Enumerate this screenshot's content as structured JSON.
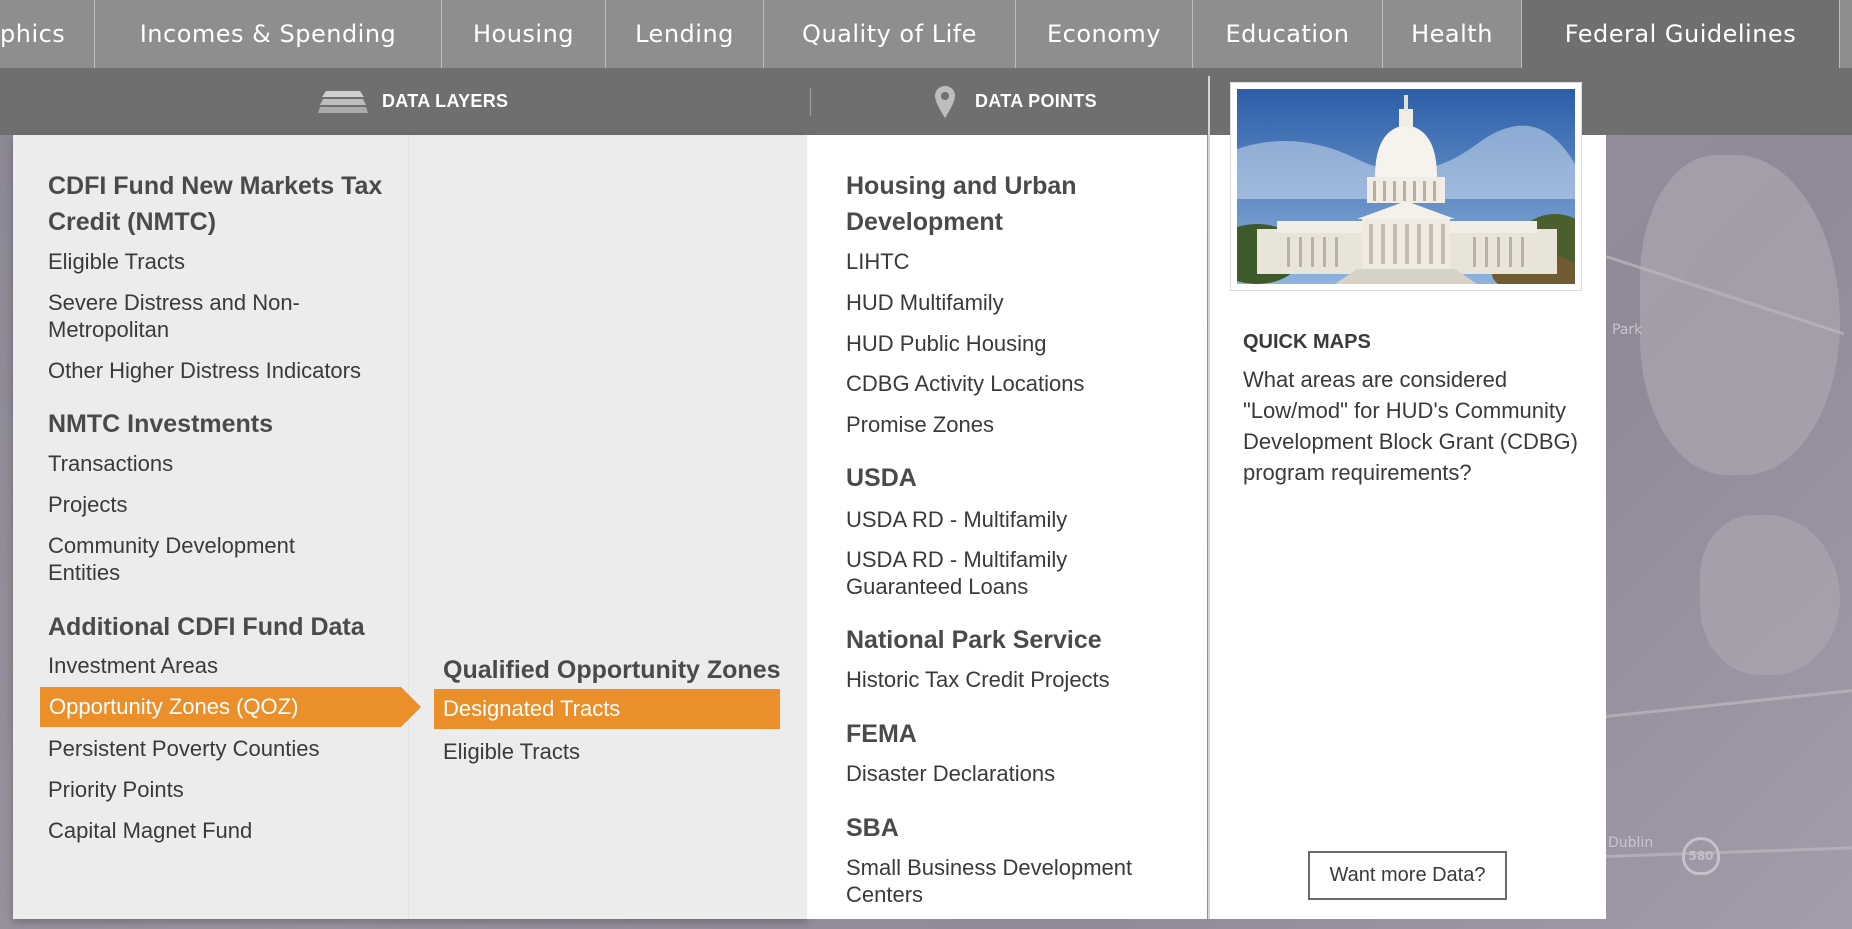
{
  "topnav": {
    "items": [
      {
        "label": "phics"
      },
      {
        "label": "Incomes & Spending"
      },
      {
        "label": "Housing"
      },
      {
        "label": "Lending"
      },
      {
        "label": "Quality of Life"
      },
      {
        "label": "Economy"
      },
      {
        "label": "Education"
      },
      {
        "label": "Health"
      },
      {
        "label": "Federal Guidelines"
      }
    ],
    "active": "Federal Guidelines"
  },
  "subheader": {
    "data_layers_label": "DATA LAYERS",
    "data_points_label": "DATA POINTS",
    "layers_icon": "layers-icon",
    "pin_icon": "map-pin-icon"
  },
  "left_column": {
    "groups": [
      {
        "heading": "CDFI Fund New Markets Tax Credit (NMTC)",
        "items": [
          "Eligible Tracts",
          "Severe Distress and Non-Metropolitan",
          "Other Higher Distress Indicators"
        ]
      },
      {
        "heading": "NMTC Investments",
        "items": [
          "Transactions",
          "Projects",
          "Community Development Entities"
        ]
      },
      {
        "heading": "Additional CDFI Fund Data",
        "items": [
          "Investment Areas",
          "Opportunity Zones (QOZ)",
          "Persistent Poverty Counties",
          "Priority Points",
          "Capital Magnet Fund"
        ]
      }
    ],
    "selected": "Opportunity Zones (QOZ)"
  },
  "sub_column": {
    "heading": "Qualified Opportunity Zones",
    "items": [
      "Designated Tracts",
      "Eligible Tracts"
    ],
    "selected": "Designated Tracts"
  },
  "data_points": {
    "groups": [
      {
        "heading": "Housing and Urban Development",
        "items": [
          "LIHTC",
          "HUD Multifamily",
          "HUD Public Housing",
          "CDBG Activity Locations",
          "Promise Zones"
        ]
      },
      {
        "heading": "USDA",
        "items": [
          "USDA RD - Multifamily",
          "USDA RD - Multifamily Guaranteed Loans"
        ]
      },
      {
        "heading": "National Park Service",
        "items": [
          "Historic Tax Credit Projects"
        ]
      },
      {
        "heading": "FEMA",
        "items": [
          "Disaster Declarations"
        ]
      },
      {
        "heading": "SBA",
        "items": [
          "Small Business Development Centers"
        ]
      }
    ]
  },
  "quick_maps": {
    "image_alt": "US Capitol building",
    "title": "QUICK MAPS",
    "question": "What areas are considered \"Low/mod\" for HUD's Community Development Block Grant (CDBG) program requirements?",
    "button_label": "Want more Data?"
  },
  "map": {
    "labels": [
      "Park",
      "Dublin"
    ],
    "highway": "580"
  },
  "colors": {
    "accent": "#ea8f2a",
    "nav_bg": "#8e8e8e",
    "nav_active_bg": "#6f6f6f",
    "panel_bg": "#ececec"
  }
}
